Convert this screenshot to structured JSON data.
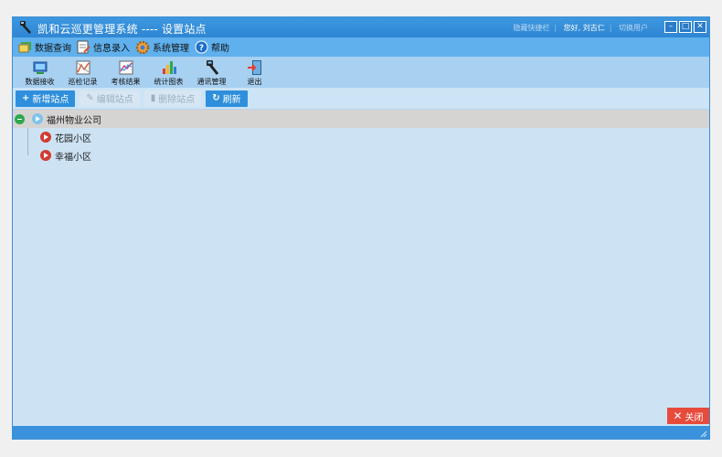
{
  "window": {
    "title": "凯和云巡更管理系统 ---- 设置站点",
    "favorites": "隐藏快捷栏",
    "greeting": "您好, 刘古仁",
    "switch_user": "切换用户"
  },
  "menu": [
    {
      "label": "数据查询",
      "icon": "data-query-icon"
    },
    {
      "label": "信息录入",
      "icon": "info-entry-icon"
    },
    {
      "label": "系统管理",
      "icon": "system-gear-icon"
    },
    {
      "label": "帮助",
      "icon": "help-icon"
    }
  ],
  "toolbar": [
    {
      "label": "数据接收"
    },
    {
      "label": "巡检记录"
    },
    {
      "label": "考核结果"
    },
    {
      "label": "统计图表"
    },
    {
      "label": "通讯管理"
    },
    {
      "label": "退出"
    }
  ],
  "actions": {
    "add": "新增站点",
    "edit": "编辑站点",
    "delete": "删除站点",
    "refresh": "刷新"
  },
  "tree": {
    "root": "福州物业公司",
    "children": [
      "花园小区",
      "幸福小区"
    ]
  },
  "close_label": "关闭",
  "colors": {
    "titlebar": "#2f86d3",
    "menubar": "#5fb0ec",
    "toolbar": "#a7d0f1",
    "content": "#cde3f4",
    "close": "#e84a3c"
  }
}
